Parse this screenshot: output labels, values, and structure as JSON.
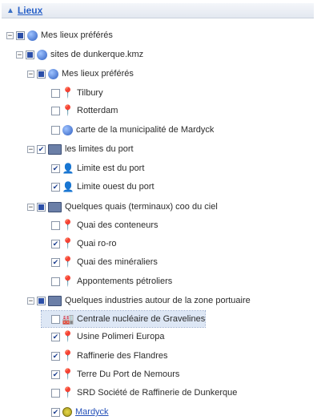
{
  "panel": {
    "title": "Lieux",
    "collapse_glyph": "▲"
  },
  "tree": [
    {
      "label": "Mes lieux préférés",
      "expander": "−",
      "check": "partial",
      "icon": "globe"
    },
    {
      "label": "sites de dunkerque.kmz",
      "expander": "−",
      "check": "partial",
      "icon": "globe"
    },
    {
      "label": "Mes lieux préférés",
      "expander": "−",
      "check": "partial",
      "icon": "globe"
    },
    {
      "label": "Tilbury",
      "expander": "",
      "check": "none",
      "icon": "pin"
    },
    {
      "label": "Rotterdam",
      "expander": "",
      "check": "none",
      "icon": "pin"
    },
    {
      "label": "carte de la municipalité de Mardyck",
      "expander": "",
      "check": "none",
      "icon": "globe"
    },
    {
      "label": "les limites du port",
      "expander": "−",
      "check": "checked",
      "icon": "folder"
    },
    {
      "label": "Limite est du port",
      "expander": "",
      "check": "checked",
      "icon": "person"
    },
    {
      "label": "Limite ouest du port",
      "expander": "",
      "check": "checked",
      "icon": "person"
    },
    {
      "label": "Quelques quais (terminaux) coo du ciel",
      "expander": "−",
      "check": "partial",
      "icon": "folder"
    },
    {
      "label": "Quai des conteneurs",
      "expander": "",
      "check": "none",
      "icon": "pin"
    },
    {
      "label": "Quai ro-ro",
      "expander": "",
      "check": "checked",
      "icon": "pin"
    },
    {
      "label": "Quai des minéraliers",
      "expander": "",
      "check": "checked",
      "icon": "pin"
    },
    {
      "label": "Appontements pétroliers",
      "expander": "",
      "check": "none",
      "icon": "pin"
    },
    {
      "label": "Quelques industries autour de la zone portuaire",
      "expander": "−",
      "check": "partial",
      "icon": "folder"
    },
    {
      "label": "Centrale nucléaire de Gravelines",
      "expander": "",
      "check": "none",
      "icon": "factory"
    },
    {
      "label": "Usine Polimeri Europa",
      "expander": "",
      "check": "checked",
      "icon": "pin"
    },
    {
      "label": "Raffinerie des Flandres",
      "expander": "",
      "check": "checked",
      "icon": "pin"
    },
    {
      "label": "Terre Du Port de Nemours",
      "expander": "",
      "check": "checked",
      "icon": "pin"
    },
    {
      "label": "SRD Société de Raffinerie de Dunkerque",
      "expander": "",
      "check": "none",
      "icon": "pin"
    },
    {
      "label": "Mardyck",
      "expander": "",
      "check": "checked",
      "icon": "dotpin",
      "link": true
    }
  ]
}
